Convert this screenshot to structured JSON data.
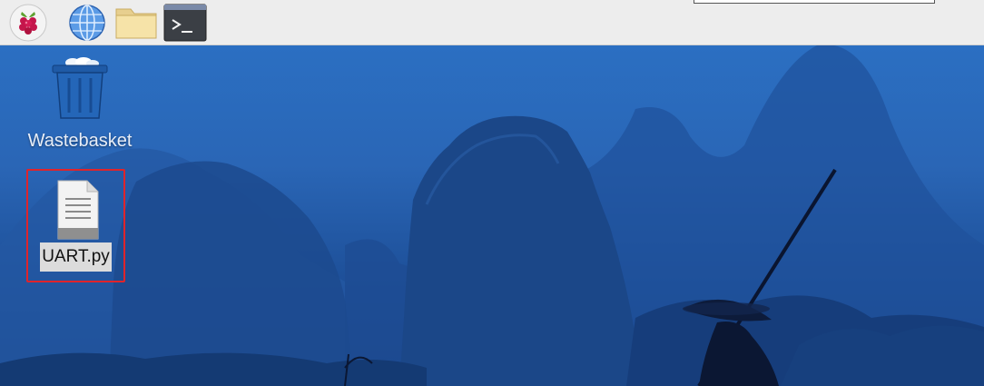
{
  "taskbar": {
    "launchers": [
      {
        "name": "Raspberry Pi menu",
        "icon": "raspberry-icon"
      },
      {
        "name": "Web Browser",
        "icon": "globe-icon"
      },
      {
        "name": "File Manager",
        "icon": "folder-icon"
      },
      {
        "name": "Terminal",
        "icon": "terminal-icon"
      }
    ]
  },
  "desktop": {
    "items": [
      {
        "label": "Wastebasket",
        "icon": "trash-icon",
        "selected": false
      },
      {
        "label": "UART.py",
        "icon": "text-file-icon",
        "selected": true
      }
    ],
    "highlight_color": "#e0242b"
  }
}
